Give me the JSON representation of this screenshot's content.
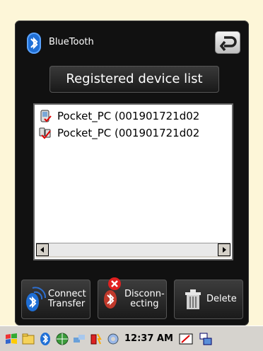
{
  "window": {
    "title": "BlueTooth",
    "registered_button": "Registered device list"
  },
  "devices": [
    {
      "name": "Pocket_PC (001901721d02"
    },
    {
      "name": "Pocket_PC (001901721d02"
    }
  ],
  "actions": {
    "connect": {
      "line1": "Connect",
      "line2": "Transfer"
    },
    "disconnect": {
      "line1": "Disconn-",
      "line2": "ecting"
    },
    "delete": {
      "label": "Delete"
    }
  },
  "taskbar": {
    "time": "12:37 AM"
  },
  "colors": {
    "panel": "#111111",
    "accent": "#1f6fd6",
    "list_bg": "#ffffff"
  },
  "icons": {
    "bluetooth": "bluetooth-icon",
    "back": "back-arrow-icon",
    "device": "pocket-pc-icon",
    "device2": "connected-devices-icon",
    "delete": "trash-icon",
    "disconnect": "disconnect-x-icon"
  }
}
